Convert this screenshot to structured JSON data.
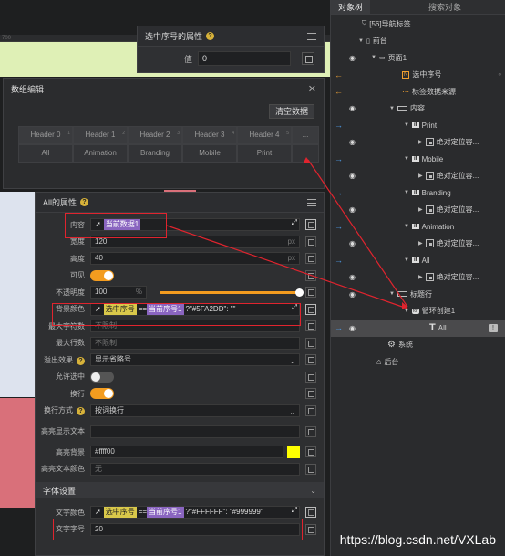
{
  "canvas": {
    "ruler": "700"
  },
  "selected_props_panel": {
    "title": "选中序号的属性",
    "value_label": "值",
    "value": "0"
  },
  "data_panel": {
    "title": "数组编辑",
    "clear_button": "清空数据",
    "header_index_marks": [
      "1",
      "2",
      "3",
      "4",
      "5"
    ],
    "headers": [
      "Header 0",
      "Header 1",
      "Header 2",
      "Header 3",
      "Header 4",
      "..."
    ],
    "values": [
      "All",
      "Animation",
      "Branding",
      "Mobile",
      "Print",
      ""
    ]
  },
  "props_panel": {
    "title": "All的属性",
    "content_label": "内容",
    "content_tag": "当前数据1",
    "width_label": "宽度",
    "width_value": "120",
    "height_label": "高度",
    "height_value": "40",
    "unit_px": "px",
    "visible_label": "可见",
    "opacity_label": "不透明度",
    "opacity_value": "100",
    "opacity_unit": "%",
    "bgcolor_label": "背景颜色",
    "bgcolor_tag1": "选中序号",
    "bgcolor_op": "==",
    "bgcolor_tag2": "当前序号1",
    "bgcolor_expr": "?\"#5FA2DD\": \"\"",
    "maxchars_label": "最大字符数",
    "maxchars_value": "不限制",
    "maxlines_label": "最大行数",
    "maxlines_value": "不限制",
    "overflow_label": "溢出效果",
    "overflow_value": "显示省略号",
    "allowselect_label": "允许选中",
    "wrap_label": "换行",
    "wrapmode_label": "换行方式",
    "wrapmode_value": "按词换行",
    "highlight_label": "高亮显示文本",
    "highlight_bg_label": "高亮背景",
    "highlight_bg_value": "#ffff00",
    "highlight_text_label": "高亮文本颜色",
    "highlight_text_value": "无",
    "font_section": "字体设置",
    "textcolor_label": "文字颜色",
    "textcolor_tag1": "选中序号",
    "textcolor_op": "==",
    "textcolor_tag2": "当前序号1",
    "textcolor_expr": "?\"#FFFFFF\": \"#999999\"",
    "fontsize_label": "文字字号",
    "fontsize_value": "20"
  },
  "tree": {
    "tabs": [
      "对象树",
      "搜索对象"
    ],
    "items": [
      "[56]导航标签",
      "前台",
      "页面1",
      "选中序号",
      "标签数据来源",
      "内容",
      "Print",
      "绝对定位容...",
      "Mobile",
      "绝对定位容...",
      "Branding",
      "绝对定位容...",
      "Animation",
      "绝对定位容...",
      "All",
      "绝对定位容...",
      "标题行",
      "循环创建1",
      "All",
      "系统",
      "后台"
    ]
  },
  "watermark": "https://blog.csdn.net/VXLab",
  "colors": {
    "accent_orange": "#f39c1f",
    "highlight_red": "#e0242e",
    "tag_yellow": "#d9c84a",
    "tag_purple": "#8a65c0",
    "highlight_bg": "#ffff00"
  }
}
